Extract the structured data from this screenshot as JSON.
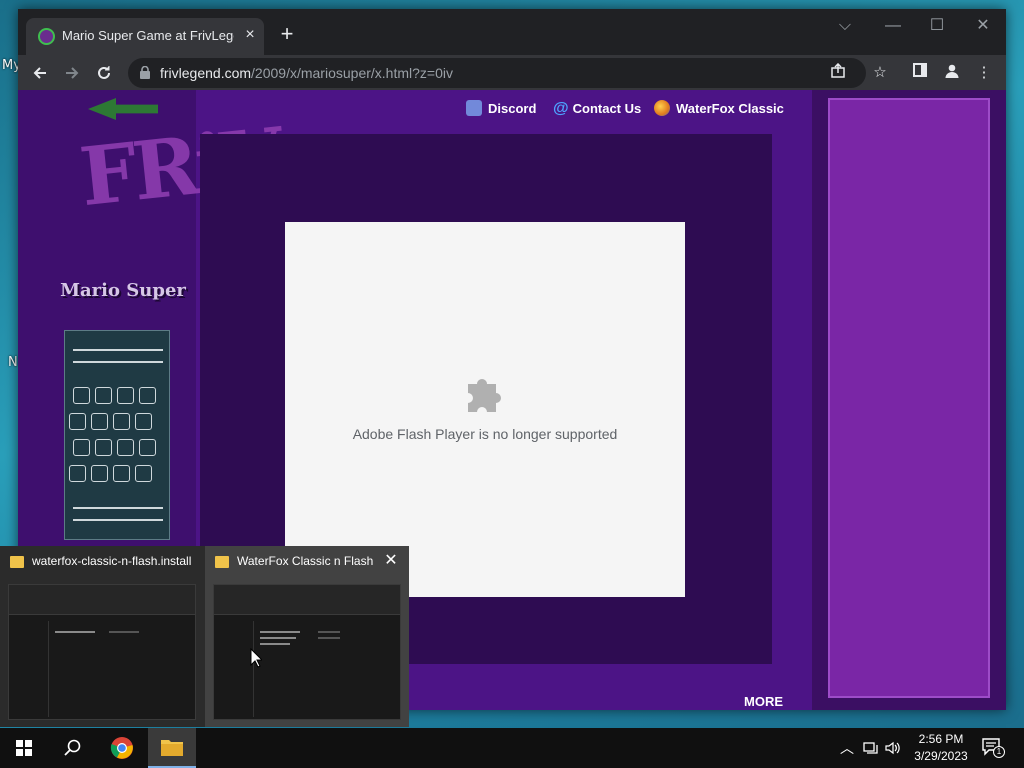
{
  "desktop": {
    "label_my": "My",
    "label_n": "N"
  },
  "browser": {
    "tab": {
      "title": "Mario Super Game at FrivLegend",
      "close": "×"
    },
    "new_tab": "+",
    "window_controls": {
      "dropdown": "⌵",
      "minimize": "—",
      "maximize": "☐",
      "close": "✕"
    },
    "url_host": "frivlegend.com",
    "url_path": "/2009/x/mariosuper/x.html?z=0iv"
  },
  "site": {
    "nav": {
      "discord": "Discord",
      "contact": "Contact Us",
      "waterfox": "WaterFox Classic"
    },
    "game_name": "Mario Super",
    "flash_message": "Adobe Flash Player is no longer supported",
    "more": "MORE"
  },
  "taskbar_thumbs": [
    {
      "title": "waterfox-classic-n-flash.install"
    },
    {
      "title": "WaterFox Classic n Flash",
      "close": "✕"
    }
  ],
  "taskbar": {
    "time": "2:56 PM",
    "date": "3/29/2023",
    "notification_count": "1"
  },
  "colors": {
    "page_purple": "#4c1486",
    "flash_bg": "#f5f5f5",
    "chrome_dark": "#202124"
  },
  "icons": [
    "back-icon",
    "forward-icon",
    "reload-icon",
    "lock-icon",
    "share-icon",
    "star-icon",
    "sidepanel-icon",
    "profile-icon",
    "menu-icon",
    "puzzle-icon",
    "folder-icon",
    "windows-icon",
    "search-icon",
    "chrome-icon"
  ]
}
